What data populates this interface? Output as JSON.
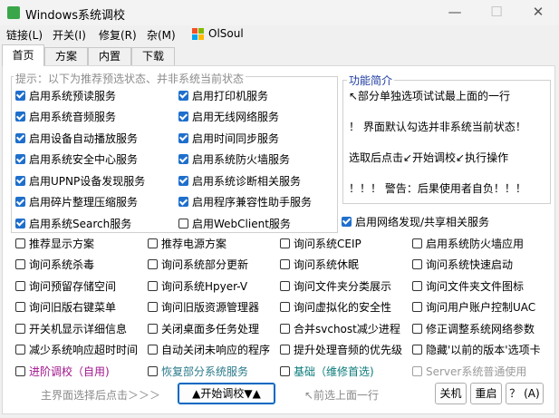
{
  "window": {
    "title": "Windows系统调校",
    "minimize": "—",
    "maximize": "☐",
    "close": "✕"
  },
  "menu": [
    {
      "label": "链接(L)"
    },
    {
      "label": "开关(I)"
    },
    {
      "label": "修复(R)"
    },
    {
      "label": "杂(M)"
    },
    {
      "label": "OlSoul"
    }
  ],
  "tabs": [
    {
      "label": "首页"
    },
    {
      "label": "方案"
    },
    {
      "label": "内置"
    },
    {
      "label": "下载"
    }
  ],
  "hint_group": {
    "legend": "提示：以下为推荐预选状态、并非系统当前状态"
  },
  "left_col": [
    {
      "label": "启用系统预读服务",
      "checked": true
    },
    {
      "label": "启用系统音频服务",
      "checked": true
    },
    {
      "label": "启用设备自动播放服务",
      "checked": true
    },
    {
      "label": "启用系统安全中心服务",
      "checked": true
    },
    {
      "label": "启用UPNP设备发现服务",
      "checked": true
    },
    {
      "label": "启用碎片整理压缩服务",
      "checked": true
    },
    {
      "label": "启用系统Search服务",
      "checked": true
    }
  ],
  "mid_col": [
    {
      "label": "启用打印机服务",
      "checked": true
    },
    {
      "label": "启用无线网络服务",
      "checked": true
    },
    {
      "label": "启用时间同步服务",
      "checked": true
    },
    {
      "label": "启用系统防火墙服务",
      "checked": true
    },
    {
      "label": "启用系统诊断相关服务",
      "checked": true
    },
    {
      "label": "启用程序兼容性助手服务",
      "checked": true
    },
    {
      "label": "启用WebClient服务",
      "checked": false
    }
  ],
  "network_option": {
    "label": "启用网络发现/共享相关服务",
    "checked": true
  },
  "intro": {
    "legend": "功能简介",
    "lines": [
      "↖部分单独选项试试最上面的一行",
      "！ 界面默认勾选并非系统当前状态！",
      "选取后点击↙开始调校↙执行操作",
      "！！！ 警告：后果使用者自负！！！"
    ]
  },
  "grid": [
    [
      "推荐显示方案",
      "推荐电源方案",
      "询问系统CEIP",
      "启用系统防火墙应用"
    ],
    [
      "询问系统杀毒",
      "询问系统部分更新",
      "询问系统休眠",
      "询问系统快速启动"
    ],
    [
      "询问预留存储空间",
      "询问系统Hpyer-V",
      "询问文件夹分类展示",
      "询问文件夹文件图标"
    ],
    [
      "询问旧版右键菜单",
      "询问旧版资源管理器",
      "询问虚拟化的安全性",
      "询问用户账户控制UAC"
    ],
    [
      "开关机显示详细信息",
      "关闭桌面多任务处理",
      "合并svchost减少进程",
      "修正调整系统网络参数"
    ],
    [
      "减少系统响应超时时间",
      "自动关闭未响应的程序",
      "提升处理音频的优先级",
      "隐藏'以前的版本'选项卡"
    ]
  ],
  "special": [
    {
      "label": "进阶调校（自用)",
      "color": "#a0148c"
    },
    {
      "label": "恢复部分系统服务",
      "color": "#2a7a8a"
    },
    {
      "label": "基础（维修首选)",
      "color": "#0a7a7a"
    },
    {
      "label": "Server系统普通使用",
      "color": "#9a9a9a"
    }
  ],
  "footer": {
    "hint_left": "主界面选择后点击＞＞＞",
    "start": "▲开始调校▼▲",
    "hint_right": "↖前选上面一行",
    "shutdown": "关机",
    "restart": "重启",
    "help": "？ (A)"
  },
  "colors": {
    "accent": "#1f6fcc",
    "intro_legend": "#1e3ca0"
  },
  "icons": [
    "app-icon",
    "windows-logo-icon",
    "minimize-icon",
    "maximize-icon",
    "close-icon",
    "checkbox-icon"
  ]
}
